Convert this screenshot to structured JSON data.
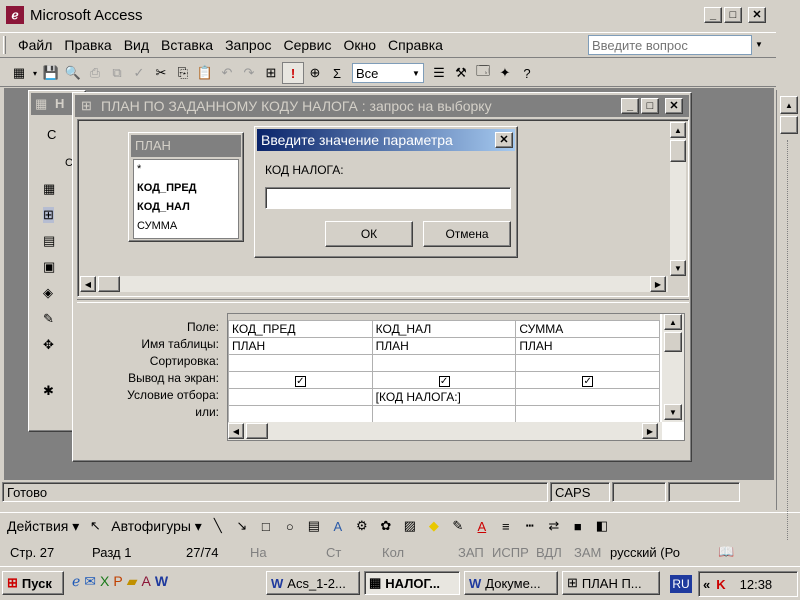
{
  "app": {
    "title": "Microsoft Access",
    "question_placeholder": "Введите вопрос"
  },
  "menu": [
    "Файл",
    "Правка",
    "Вид",
    "Вставка",
    "Запрос",
    "Сервис",
    "Окно",
    "Справка"
  ],
  "toolbar": {
    "totals_value": "Все"
  },
  "db_window": {
    "title_short": "Н",
    "left_label": "С",
    "left_tab": "С"
  },
  "query_window": {
    "title": "ПЛАН ПО ЗАДАННОМУ КОДУ НАЛОГА : запрос на выборку",
    "table": {
      "name": "ПЛАН",
      "fields": [
        "*",
        "КОД_ПРЕД",
        "КОД_НАЛ",
        "СУММА"
      ]
    },
    "grid": {
      "row_labels": [
        "Поле:",
        "Имя таблицы:",
        "Сортировка:",
        "Вывод на экран:",
        "Условие отбора:",
        "или:"
      ],
      "columns": [
        {
          "field": "КОД_ПРЕД",
          "table": "ПЛАН",
          "sort": "",
          "show": true,
          "criteria": "",
          "or": ""
        },
        {
          "field": "КОД_НАЛ",
          "table": "ПЛАН",
          "sort": "",
          "show": true,
          "criteria": "[КОД НАЛОГА:]",
          "or": ""
        },
        {
          "field": "СУММА",
          "table": "ПЛАН",
          "sort": "",
          "show": true,
          "criteria": "",
          "or": ""
        }
      ]
    }
  },
  "dialog": {
    "title": "Введите значение параметра",
    "prompt": "КОД НАЛОГА:",
    "value": "",
    "ok": "ОК",
    "cancel": "Отмена"
  },
  "status": {
    "ready": "Готово",
    "caps": "CAPS"
  },
  "drawing": {
    "actions": "Действия",
    "autoshapes": "Автофигуры"
  },
  "word_status": {
    "page": "Стр. 27",
    "section": "Разд 1",
    "pages": "27/74",
    "at": "На",
    "line": "Ст",
    "col": "Кол",
    "rec": "ЗАП",
    "trk": "ИСПР",
    "ext": "ВДЛ",
    "ovr": "ЗАМ",
    "lang": "русский (Ро"
  },
  "taskbar": {
    "start": "Пуск",
    "tasks": [
      "Acs_1-2...",
      "НАЛОГ...",
      "Докуме...",
      "ПЛАН П..."
    ],
    "lang": "RU",
    "clock": "12:38"
  },
  "colors": {
    "title_active": "#0a246a",
    "title_inactive": "#808080",
    "desktop_bg": "#808080"
  }
}
